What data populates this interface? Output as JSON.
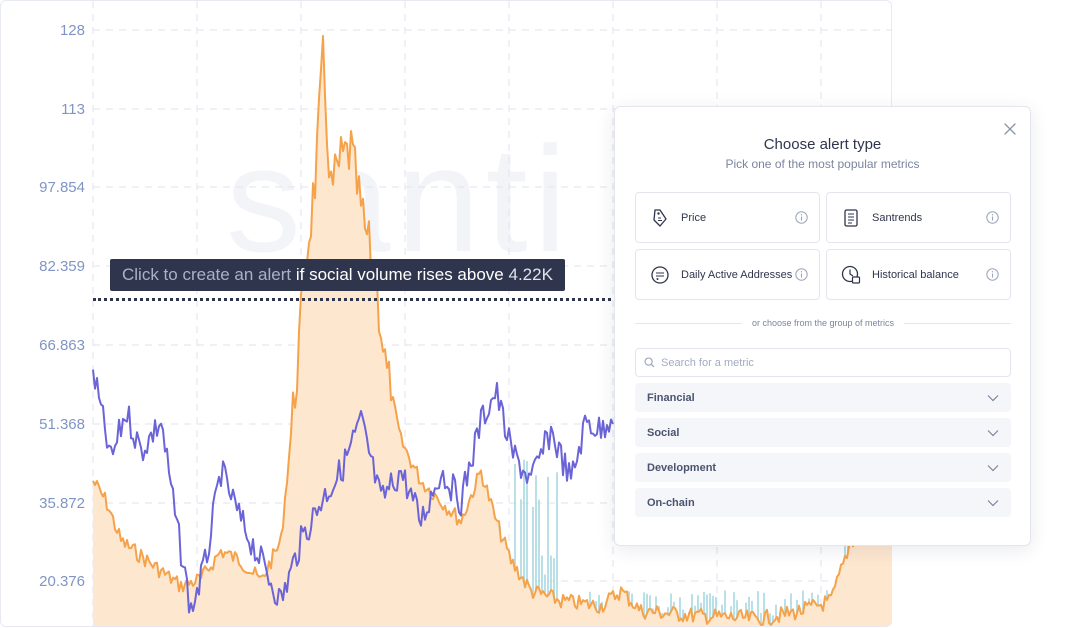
{
  "chart": {
    "watermark": "santi",
    "y_ticks": [
      "128",
      "113",
      "97.854",
      "82.359",
      "66.863",
      "51.368",
      "35.872",
      "20.376"
    ],
    "colors": {
      "price_line": "#6b64d8",
      "social_line": "#f5a24a",
      "social_area": "#fde7cf",
      "volume_bars": "#a6d8e0",
      "grid": "#dfe3ec",
      "tick_text": "#8095c4"
    }
  },
  "alert_hint": {
    "prefix": "Click to create an alert",
    "condition": "if social volume rises above",
    "value": "4.22K"
  },
  "modal": {
    "title": "Choose alert type",
    "subtitle": "Pick one of the most popular metrics",
    "types": [
      {
        "label": "Price",
        "icon": "price-tag-icon"
      },
      {
        "label": "Santrends",
        "icon": "document-icon"
      },
      {
        "label": "Daily Active Addresses",
        "icon": "addresses-icon"
      },
      {
        "label": "Historical balance",
        "icon": "balance-clock-icon"
      }
    ],
    "divider_text": "or choose from the group of metrics",
    "search": {
      "placeholder": "Search for a metric",
      "value": ""
    },
    "groups": [
      "Financial",
      "Social",
      "Development",
      "On-chain"
    ]
  }
}
